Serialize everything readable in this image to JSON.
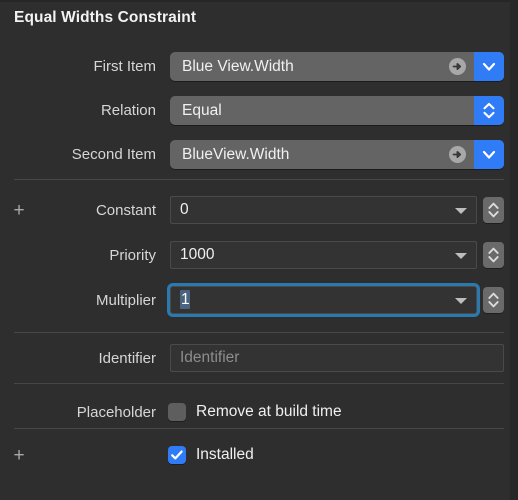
{
  "panel": {
    "title": "Equal Widths Constraint",
    "accent_blue": "#2f7cf6",
    "focus_ring": "#2a7ab0",
    "background": "#2e2e2e",
    "popup_fill": "#646464",
    "field_fill": "#333333"
  },
  "rows": {
    "first_item": {
      "label": "First Item",
      "value": "Blue View.Width",
      "cap_icon": "chevron-down-icon",
      "reveal_icon": "arrow-right-circle-icon"
    },
    "relation": {
      "label": "Relation",
      "value": "Equal",
      "cap_icon": "chevron-up-down-icon"
    },
    "second_item": {
      "label": "Second Item",
      "value": "BlueView.Width",
      "cap_icon": "chevron-down-icon",
      "reveal_icon": "arrow-right-circle-icon"
    },
    "constant": {
      "label": "Constant",
      "value": "0",
      "add_icon": "plus-icon",
      "dropdown_icon": "triangle-down-icon",
      "stepper_icon": "stepper-up-down-icon"
    },
    "priority": {
      "label": "Priority",
      "value": "1000",
      "dropdown_icon": "triangle-down-icon",
      "stepper_icon": "stepper-up-down-icon"
    },
    "multiplier": {
      "label": "Multiplier",
      "value": "1",
      "focused": true,
      "text_selected": true,
      "dropdown_icon": "triangle-down-icon",
      "stepper_icon": "stepper-up-down-icon"
    },
    "identifier": {
      "label": "Identifier",
      "value": "",
      "placeholder": "Identifier"
    },
    "placeholder_row": {
      "label": "Placeholder",
      "checkbox_label": "Remove at build time",
      "checked": false
    },
    "installed_row": {
      "label": "",
      "checkbox_label": "Installed",
      "checked": true,
      "add_icon": "plus-icon"
    }
  }
}
